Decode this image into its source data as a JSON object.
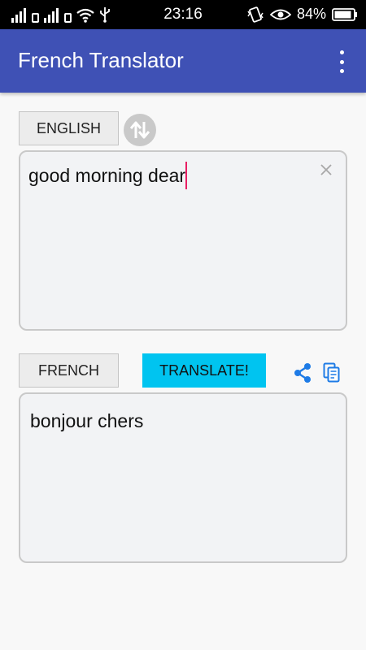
{
  "status_bar": {
    "time": "23:16",
    "battery": "84%"
  },
  "app_bar": {
    "title": "French Translator",
    "menu_icon": "more-vert-icon"
  },
  "source": {
    "language_label": "ENGLISH",
    "text": "good morning dear"
  },
  "target": {
    "language_label": "FRENCH",
    "translate_label": "TRANSLATE!",
    "text": "bonjour chers"
  },
  "colors": {
    "app_bar": "#3f51b5",
    "translate_button": "#00c4f0",
    "action_icons": "#1e7be6",
    "caret": "#e91e63"
  },
  "icons": [
    "signal-icon",
    "sim-icon",
    "wifi-icon",
    "usb-icon",
    "vibrate-icon",
    "eye-icon",
    "battery-icon",
    "swap-icon",
    "clear-icon",
    "share-icon",
    "copy-icon"
  ]
}
